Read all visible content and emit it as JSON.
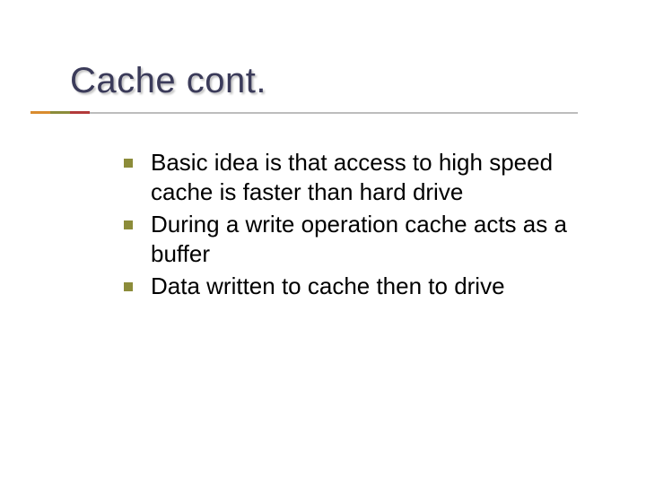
{
  "title": "Cache cont.",
  "bullets": [
    "Basic idea is that access to high speed cache is faster than hard drive",
    "During a write operation cache acts as a buffer",
    "Data written to cache then to drive"
  ],
  "colors": {
    "title": "#3b3b5a",
    "bullet": "#8c8c3a",
    "underline_segments": [
      "#d98c2e",
      "#8c8c3a",
      "#b23a3a",
      "#bdbdbd"
    ]
  }
}
